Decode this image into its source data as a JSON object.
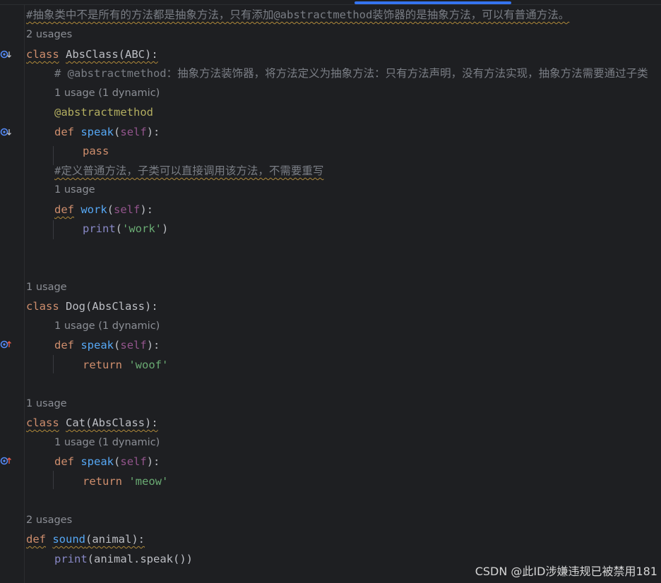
{
  "editor": {
    "lines": [
      {
        "id": "l1",
        "text": "#抽象类中不是所有的方法都是抽象方法，只有添加@abstractmethod装饰器的是抽象方法，可以有普通方法。"
      },
      {
        "id": "h1",
        "text": "2 usages"
      },
      {
        "id": "l2",
        "kw": "class",
        "name": "AbsClass(ABC):"
      },
      {
        "id": "l3",
        "text": "# @abstractmethod：抽象方法装饰器，将方法定义为抽象方法：只有方法声明，没有方法实现，抽象方法需要通过子类"
      },
      {
        "id": "h2",
        "text": "1 usage (1 dynamic)"
      },
      {
        "id": "l4",
        "text": "@abstractmethod"
      },
      {
        "id": "l5",
        "kw": "def",
        "fn": "speak",
        "self": "self",
        "end": "):"
      },
      {
        "id": "l6",
        "text": "pass"
      },
      {
        "id": "l7",
        "text": "#定义普通方法，子类可以直接调用该方法，不需要重写"
      },
      {
        "id": "h3",
        "text": "1 usage"
      },
      {
        "id": "l8",
        "kw": "def",
        "fn": "work",
        "self": "self",
        "end": "):"
      },
      {
        "id": "l9",
        "builtin": "print",
        "str": "'work'"
      },
      {
        "id": "h4",
        "text": "1 usage"
      },
      {
        "id": "l10",
        "kw": "class",
        "name": "Dog(AbsClass):"
      },
      {
        "id": "h5",
        "text": "1 usage (1 dynamic)"
      },
      {
        "id": "l11",
        "kw": "def",
        "fn": "speak",
        "self": "self",
        "end": "):"
      },
      {
        "id": "l12",
        "kw": "return",
        "str": "'woof'"
      },
      {
        "id": "h6",
        "text": "1 usage"
      },
      {
        "id": "l13",
        "kw": "class",
        "name": "Cat(AbsClass):"
      },
      {
        "id": "h7",
        "text": "1 usage (1 dynamic)"
      },
      {
        "id": "l14",
        "kw": "def",
        "fn": "speak",
        "self": "self",
        "end": "):"
      },
      {
        "id": "l15",
        "kw": "return",
        "str": "'meow'"
      },
      {
        "id": "h8",
        "text": "2 usages"
      },
      {
        "id": "l16",
        "kw": "def",
        "fn": "sound",
        "arg": "(animal):"
      },
      {
        "id": "l17",
        "builtin": "print",
        "rest": "(animal.speak())"
      }
    ]
  },
  "watermark": "CSDN @此ID涉嫌违规已被禁用181",
  "colors": {
    "background": "#1e1f22",
    "keyword": "#cf8e6d",
    "function": "#56a8f5",
    "self": "#94558d",
    "string": "#6aab73",
    "decorator": "#b3ae60",
    "comment": "#7a7e85",
    "hint": "#8c8f96",
    "accent": "#3574f0"
  },
  "icons": [
    "implemented-icon",
    "overrides-icon"
  ]
}
